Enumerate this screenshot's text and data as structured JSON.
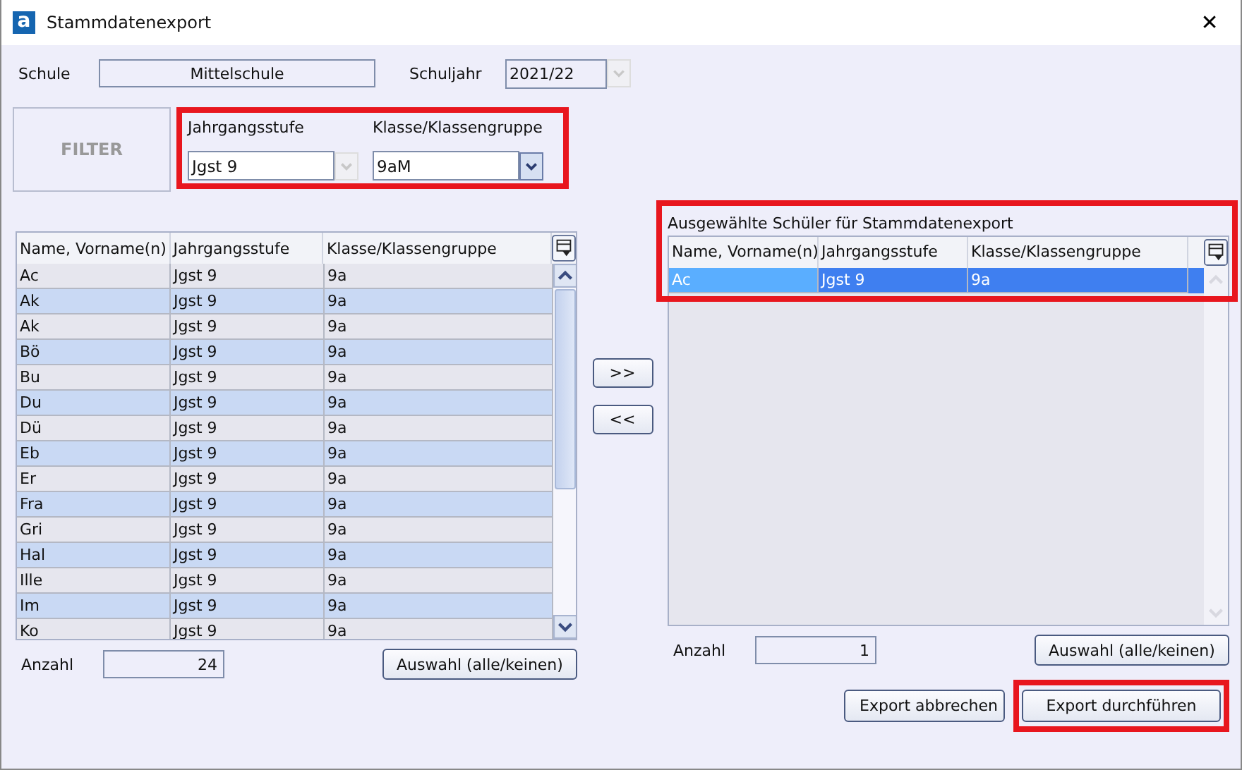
{
  "window": {
    "title": "Stammdatenexport",
    "logo": "a",
    "close": "✕"
  },
  "school": {
    "label": "Schule",
    "value": "Mittelschule"
  },
  "year": {
    "label": "Schuljahr",
    "value": "2021/22",
    "disabled": true
  },
  "filter": {
    "title": "FILTER",
    "highlighted": true,
    "fields": [
      {
        "label": "Jahrgangsstufe",
        "value": "Jgst 9",
        "disabled": true
      },
      {
        "label": "Klasse/Klassengruppe",
        "value": "9aM",
        "disabled": false
      }
    ]
  },
  "left_table": {
    "columns": [
      "Name, Vorname(n)",
      "Jahrgangsstufe",
      "Klasse/Klassengruppe"
    ],
    "rows": [
      [
        "Ac",
        "Jgst 9",
        "9a"
      ],
      [
        "Ak",
        "Jgst 9",
        "9a"
      ],
      [
        "Ak",
        "Jgst 9",
        "9a"
      ],
      [
        "Bö",
        "Jgst 9",
        "9a"
      ],
      [
        "Bu",
        "Jgst 9",
        "9a"
      ],
      [
        "Du",
        "Jgst 9",
        "9a"
      ],
      [
        "Dü",
        "Jgst 9",
        "9a"
      ],
      [
        "Eb",
        "Jgst 9",
        "9a"
      ],
      [
        "Er",
        "Jgst 9",
        "9a"
      ],
      [
        "Fra",
        "Jgst 9",
        "9a"
      ],
      [
        "Gri",
        "Jgst 9",
        "9a"
      ],
      [
        "Hal",
        "Jgst 9",
        "9a"
      ],
      [
        "Ille",
        "Jgst 9",
        "9a"
      ],
      [
        "Im",
        "Jgst 9",
        "9a"
      ],
      [
        "Ko",
        "Jgst 9",
        "9a"
      ]
    ],
    "count_label": "Anzahl",
    "count": "24",
    "select_button": "Auswahl (alle/keinen)"
  },
  "move_buttons": [
    ">>",
    "<<"
  ],
  "right_table": {
    "title": "Ausgewählte Schüler für Stammdatenexport",
    "highlighted": true,
    "columns": [
      "Name, Vorname(n)",
      "Jahrgangsstufe",
      "Klasse/Klassengruppe"
    ],
    "rows": [
      {
        "cells": [
          "Ac",
          "Jgst 9",
          "9a"
        ],
        "selected": true
      }
    ],
    "count_label": "Anzahl",
    "count": "1",
    "select_button": "Auswahl (alle/keinen)"
  },
  "buttons": [
    {
      "label": "Export abbrechen",
      "highlighted": false
    },
    {
      "label": "Export durchführen",
      "highlighted": true
    }
  ]
}
